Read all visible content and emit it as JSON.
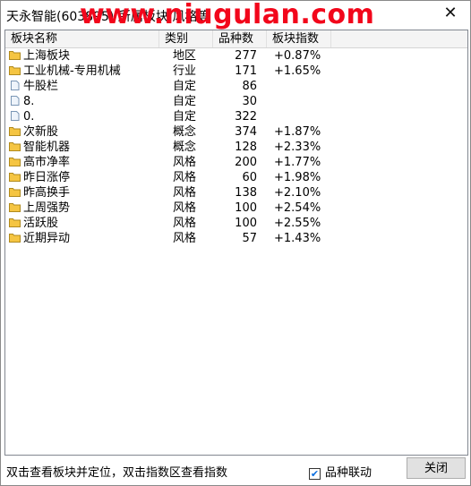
{
  "window": {
    "title": "天永智能(603895) 所属板块/风格等",
    "watermark": "www.niugulan.com",
    "close_glyph": "✕"
  },
  "table": {
    "columns": [
      "板块名称",
      "类别",
      "品种数",
      "板块指数"
    ],
    "rows": [
      {
        "name": "上海板块",
        "type": "地区",
        "count": "277",
        "index": "+0.87%",
        "icon": "folder-icon"
      },
      {
        "name": "工业机械-专用机械",
        "type": "行业",
        "count": "171",
        "index": "+1.65%",
        "icon": "folder-icon"
      },
      {
        "name": "牛股栏",
        "type": "自定",
        "count": "86",
        "index": "",
        "icon": "document-icon"
      },
      {
        "name": "8.",
        "type": "自定",
        "count": "30",
        "index": "",
        "icon": "document-icon"
      },
      {
        "name": "0.",
        "type": "自定",
        "count": "322",
        "index": "",
        "icon": "document-icon"
      },
      {
        "name": "次新股",
        "type": "概念",
        "count": "374",
        "index": "+1.87%",
        "icon": "folder-icon"
      },
      {
        "name": "智能机器",
        "type": "概念",
        "count": "128",
        "index": "+2.33%",
        "icon": "folder-icon"
      },
      {
        "name": "高市净率",
        "type": "风格",
        "count": "200",
        "index": "+1.77%",
        "icon": "folder-icon"
      },
      {
        "name": "昨日涨停",
        "type": "风格",
        "count": "60",
        "index": "+1.98%",
        "icon": "folder-icon"
      },
      {
        "name": "昨高换手",
        "type": "风格",
        "count": "138",
        "index": "+2.10%",
        "icon": "folder-icon"
      },
      {
        "name": "上周强势",
        "type": "风格",
        "count": "100",
        "index": "+2.54%",
        "icon": "folder-icon"
      },
      {
        "name": "活跃股",
        "type": "风格",
        "count": "100",
        "index": "+2.55%",
        "icon": "folder-icon"
      },
      {
        "name": "近期异动",
        "type": "风格",
        "count": "57",
        "index": "+1.43%",
        "icon": "folder-icon"
      }
    ]
  },
  "footer": {
    "hint": "双击查看板块并定位，双击指数区查看指数",
    "checkbox_label": "品种联动",
    "checkbox_checked": true,
    "close_label": "关闭"
  },
  "colors": {
    "watermark": "#f2061b",
    "folder": "#f5c542",
    "checkmark": "#0a6ee0"
  }
}
